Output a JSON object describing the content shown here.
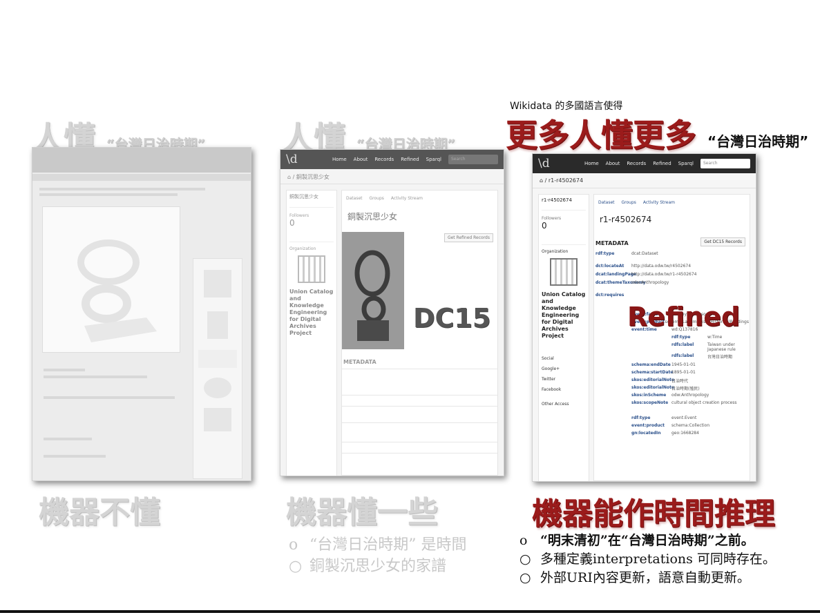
{
  "columns": [
    {
      "heading_main": "人懂",
      "heading_quote": "“台灣日治時期”",
      "footer": "機器不懂"
    },
    {
      "heading_main": "人懂",
      "heading_quote": "“台灣日治時期”",
      "footer": "機器懂一些",
      "bullets": [
        {
          "marker": "o",
          "text": "“台灣日治時期” 是時間"
        },
        {
          "marker": "○",
          "text": "銅製沉思少女的家譜"
        }
      ]
    },
    {
      "kicker": "Wikidata 的多國語言使得",
      "heading_main": "更多人懂更多",
      "heading_quote": "“台灣日治時期”",
      "footer": "機器能作時間推理",
      "bullets": [
        {
          "marker": "o",
          "text": "“明末清初”在“台灣日治時期”之前。"
        },
        {
          "marker": "○",
          "text": "多種定義interpretations 可同時存在。"
        },
        {
          "marker": "○",
          "text": "外部URI內容更新，語意自動更新。"
        }
      ]
    }
  ],
  "shot2": {
    "nav": [
      "Home",
      "About",
      "Records",
      "Refined",
      "Sparql"
    ],
    "search_placeholder": "Search",
    "breadcrumb": "/ 銅製沉思少女",
    "sidebar_title": "銅製沉思少女",
    "followers_label": "Followers",
    "followers_value": "0",
    "org_label": "Organization",
    "org_name": "Union Catalog and Knowledge Engineering for Digital Archives Project",
    "tabs": [
      "Dataset",
      "Groups",
      "Activity Stream"
    ],
    "record_title": "銅製沉思少女",
    "refined_button": "Get Refined Records",
    "metadata_label": "METADATA",
    "overlay": "DC15"
  },
  "shot3": {
    "nav": [
      "Home",
      "About",
      "Records",
      "Refined",
      "Sparql"
    ],
    "search_placeholder": "Search",
    "breadcrumb": "/ r1-r4502674",
    "sidebar_title": "r1-r4502674",
    "followers_label": "Followers",
    "followers_value": "0",
    "org_label": "Organization",
    "org_name": "Union Catalog and Knowledge Engineering for Digital Archives Project",
    "tabs": [
      "Dataset",
      "Groups",
      "Activity Stream"
    ],
    "record_title": "r1-r4502674",
    "metadata_label": "METADATA",
    "dc15_button": "Get DC15 Records",
    "side_links": [
      "Social",
      "Google+",
      "Twitter",
      "Facebook",
      "Other Access"
    ],
    "rows": [
      {
        "k": "rdf:type",
        "v": "dcat:Dataset"
      },
      {
        "k": "dct:locateAt",
        "v": "http://data.odw.tw/r4502674"
      },
      {
        "k": "dcat:landingPage",
        "v": "http://data.odw.tw/r1-r4502674"
      },
      {
        "k": "dcat:themeTaxonomy",
        "v": "odw:Anthropology"
      },
      {
        "k": "dct:requires",
        "v": ""
      },
      {
        "k": "event:factor",
        "v": "dcf:PhysicalResource"
      },
      {
        "k": "event:product",
        "v": "schema:LandmarksOrHistoricalBuildings"
      },
      {
        "k": "event:time",
        "v": "wd:Q137816"
      },
      {
        "k": "rdf:type",
        "v": "w:Time"
      },
      {
        "k": "rdfs:label",
        "v": "Taiwan under Japanese rule"
      },
      {
        "k": "rdfs:label",
        "v": "台灣日治時期"
      },
      {
        "k": "schema:endDate",
        "v": "1945-01-01"
      },
      {
        "k": "schema:startDate",
        "v": "1895-01-01"
      },
      {
        "k": "skos:editorialNote",
        "v": "日治時代"
      },
      {
        "k": "skos:editorialNote",
        "v": "日治時期(殖民)"
      },
      {
        "k": "skos:inScheme",
        "v": "odw:Anthropology"
      },
      {
        "k": "skos:scopeNote",
        "v": "cultural object creation process"
      },
      {
        "k": "rdf:type",
        "v": "event:Event"
      },
      {
        "k": "event:product",
        "v": "schema:Collection"
      },
      {
        "k": "gn:locatedIn",
        "v": "geo:1668284"
      }
    ],
    "overlay": "Refined"
  },
  "colors": {
    "red": "#9b1b1b",
    "gray": "#d4d4d4"
  }
}
